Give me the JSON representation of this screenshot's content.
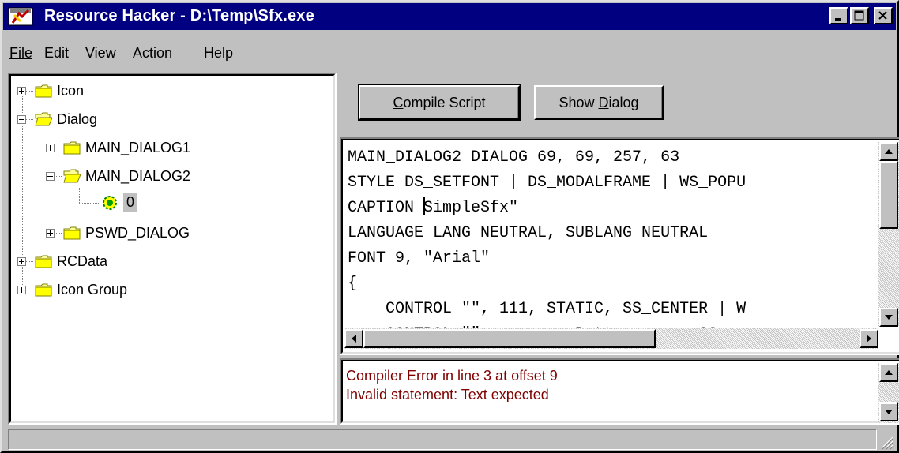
{
  "window": {
    "title": "Resource Hacker  -  D:\\Temp\\Sfx.exe",
    "caption_buttons": [
      "minimize-icon",
      "maximize-icon",
      "close-icon"
    ],
    "title_bar_color": "#000080"
  },
  "menu": {
    "file": "File",
    "edit": "Edit",
    "view": "View",
    "action": "Action",
    "help": "Help"
  },
  "tree": {
    "icon": "Icon",
    "dialog": "Dialog",
    "main_dialog1": "MAIN_DIALOG1",
    "main_dialog2": "MAIN_DIALOG2",
    "lang_0": "0",
    "pswd_dialog": "PSWD_DIALOG",
    "rcdata": "RCData",
    "icon_group": "Icon Group"
  },
  "toolbar": {
    "compile_pre": "",
    "compile_key": "C",
    "compile_post": "ompile Script",
    "show_pre": "Show ",
    "show_key": "D",
    "show_post": "ialog"
  },
  "script": {
    "line1": "MAIN_DIALOG2 DIALOG 69, 69, 257, 63",
    "line2": "STYLE DS_SETFONT | DS_MODALFRAME | WS_POPU",
    "line3_pre": "CAPTION ",
    "line3_post": "SimpleSfx\"",
    "line4": "LANGUAGE LANG_NEUTRAL, SUBLANG_NEUTRAL",
    "line5": "FONT 9, \"Arial\"",
    "line6": "{",
    "line7": "    CONTROL \"\", 111, STATIC, SS_CENTER | W",
    "line8": "    CONTROL \"\"        , Button, ..., SS"
  },
  "errors": {
    "line1": "Compiler Error in line 3 at offset 9",
    "line2": "Invalid statement: Text expected",
    "color": "#800000"
  },
  "status": {
    "text": ""
  }
}
